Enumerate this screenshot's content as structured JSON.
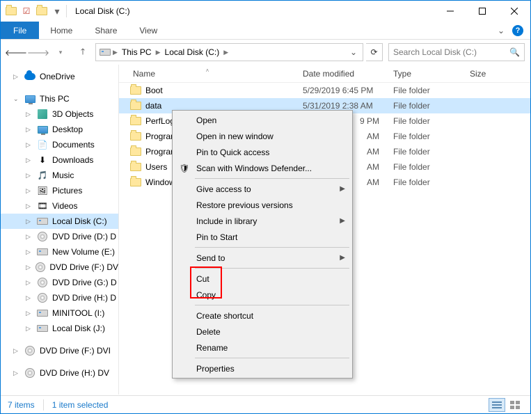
{
  "window": {
    "title": "Local Disk (C:)"
  },
  "ribbon": {
    "file": "File",
    "home": "Home",
    "share": "Share",
    "view": "View"
  },
  "breadcrumb": {
    "this_pc": "This PC",
    "drive": "Local Disk (C:)"
  },
  "search": {
    "placeholder": "Search Local Disk (C:)"
  },
  "nav": {
    "onedrive": "OneDrive",
    "this_pc": "This PC",
    "items": [
      {
        "label": "3D Objects"
      },
      {
        "label": "Desktop"
      },
      {
        "label": "Documents"
      },
      {
        "label": "Downloads"
      },
      {
        "label": "Music"
      },
      {
        "label": "Pictures"
      },
      {
        "label": "Videos"
      },
      {
        "label": "Local Disk (C:)"
      },
      {
        "label": "DVD Drive (D:) D"
      },
      {
        "label": "New Volume (E:)"
      },
      {
        "label": "DVD Drive (F:) DV"
      },
      {
        "label": "DVD Drive (G:) D"
      },
      {
        "label": "DVD Drive (H:) D"
      },
      {
        "label": "MINITOOL (I:)"
      },
      {
        "label": "Local Disk (J:)"
      },
      {
        "label": "DVD Drive (F:) DVI"
      },
      {
        "label": "DVD Drive (H:) DV"
      }
    ]
  },
  "columns": {
    "name": "Name",
    "date": "Date modified",
    "type": "Type",
    "size": "Size"
  },
  "files": [
    {
      "name": "Boot",
      "date": "5/29/2019 6:45 PM",
      "type": "File folder"
    },
    {
      "name": "data",
      "date": "5/31/2019 2:38 AM",
      "type": "File folder"
    },
    {
      "name": "PerfLogs",
      "date": "",
      "type": "File folder",
      "date_suffix": "9 PM"
    },
    {
      "name": "Program",
      "date": "",
      "type": "File folder",
      "date_suffix": "AM"
    },
    {
      "name": "Program",
      "date": "",
      "type": "File folder",
      "date_suffix": "AM"
    },
    {
      "name": "Users",
      "date": "",
      "type": "File folder",
      "date_suffix": "AM"
    },
    {
      "name": "Window",
      "date": "",
      "type": "File folder",
      "date_suffix": "AM"
    }
  ],
  "context_menu": {
    "open": "Open",
    "open_new": "Open in new window",
    "pin_quick": "Pin to Quick access",
    "scan_defender": "Scan with Windows Defender...",
    "give_access": "Give access to",
    "restore": "Restore previous versions",
    "include_lib": "Include in library",
    "pin_start": "Pin to Start",
    "send_to": "Send to",
    "cut": "Cut",
    "copy": "Copy",
    "shortcut": "Create shortcut",
    "delete": "Delete",
    "rename": "Rename",
    "properties": "Properties"
  },
  "status": {
    "items": "7 items",
    "selected": "1 item selected"
  }
}
